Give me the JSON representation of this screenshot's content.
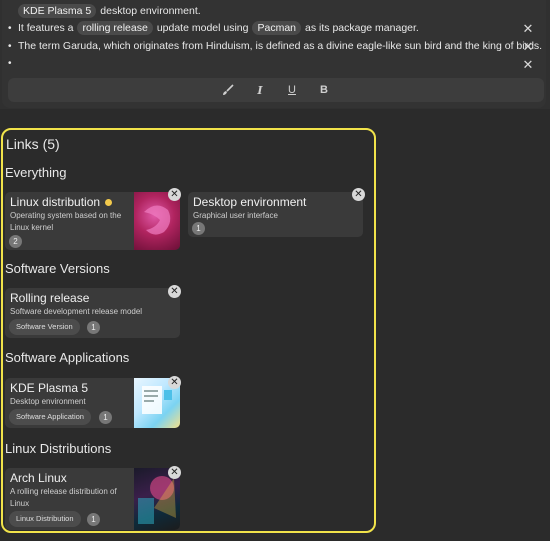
{
  "notes": {
    "lines": [
      {
        "before": "",
        "chip": "KDE Plasma 5",
        "after": "desktop environment."
      },
      {
        "before": "It features a",
        "chip": "rolling release",
        "middle": "update model using",
        "chip2": "Pacman",
        "after": "as its package manager."
      },
      {
        "text": "The term Garuda, which originates from Hinduism, is defined as a divine eagle-like sun bird and the king of birds."
      },
      {
        "text": ""
      }
    ]
  },
  "toolbar": {
    "bold_label": "B",
    "italic_label": "I",
    "underline_label": "U"
  },
  "links": {
    "title": "Links (5)",
    "groups": [
      {
        "title": "Everything",
        "cards": [
          {
            "title": "Linux distribution",
            "desc": "Operating system based on the Linux kernel",
            "count": "2",
            "dot_color": "#f2c94c"
          },
          {
            "title": "Desktop environment",
            "desc": "Graphical user interface",
            "count": "1"
          }
        ]
      },
      {
        "title": "Software Versions",
        "cards": [
          {
            "title": "Rolling release",
            "desc": "Software development release model",
            "tag": "Software Version",
            "count": "1"
          }
        ]
      },
      {
        "title": "Software Applications",
        "cards": [
          {
            "title": "KDE Plasma 5",
            "desc": "Desktop environment",
            "tag": "Software Application",
            "count": "1"
          }
        ]
      },
      {
        "title": "Linux Distributions",
        "cards": [
          {
            "title": "Arch Linux",
            "desc": "A rolling release distribution of Linux",
            "tag": "Linux Distribution",
            "count": "1"
          }
        ]
      }
    ]
  }
}
